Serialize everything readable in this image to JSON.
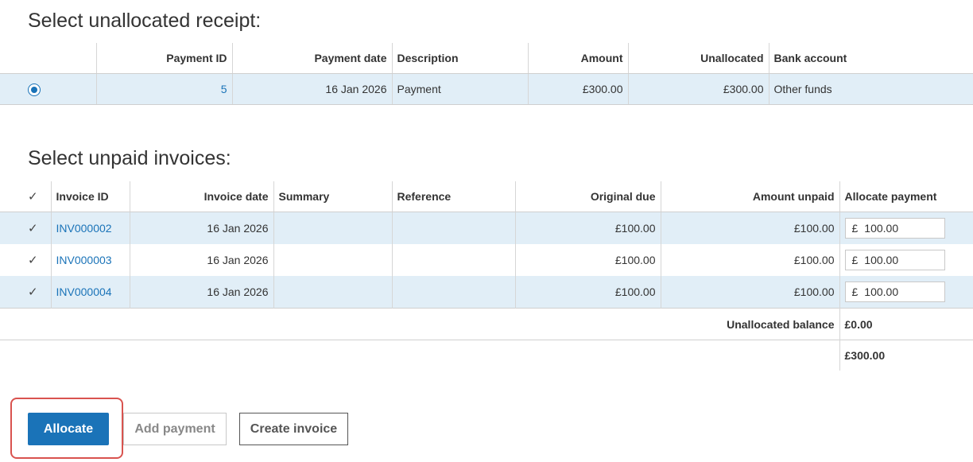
{
  "receipt_section": {
    "title": "Select unallocated receipt:",
    "columns": [
      "Payment ID",
      "Payment date",
      "Description",
      "Amount",
      "Unallocated",
      "Bank account"
    ],
    "row": {
      "selected": true,
      "payment_id": "5",
      "payment_date": "16 Jan 2026",
      "description": "Payment",
      "amount": "£300.00",
      "unallocated": "£300.00",
      "bank_account": "Other funds"
    }
  },
  "invoice_section": {
    "title": "Select unpaid invoices:",
    "select_all_checked": true,
    "columns": [
      "Invoice ID",
      "Invoice date",
      "Summary",
      "Reference",
      "Original due",
      "Amount unpaid",
      "Allocate payment"
    ],
    "rows": [
      {
        "checked": true,
        "invoice_id": "INV000002",
        "invoice_date": "16 Jan 2026",
        "summary": "",
        "reference": "",
        "original_due": "£100.00",
        "amount_unpaid": "£100.00",
        "currency_symbol": "£",
        "allocate_value": "100.00"
      },
      {
        "checked": true,
        "invoice_id": "INV000003",
        "invoice_date": "16 Jan 2026",
        "summary": "",
        "reference": "",
        "original_due": "£100.00",
        "amount_unpaid": "£100.00",
        "currency_symbol": "£",
        "allocate_value": "100.00"
      },
      {
        "checked": true,
        "invoice_id": "INV000004",
        "invoice_date": "16 Jan 2026",
        "summary": "",
        "reference": "",
        "original_due": "£100.00",
        "amount_unpaid": "£100.00",
        "currency_symbol": "£",
        "allocate_value": "100.00"
      }
    ],
    "unallocated_balance_label": "Unallocated balance",
    "unallocated_balance_value": "£0.00",
    "total_value": "£300.00"
  },
  "actions": {
    "allocate_label": "Allocate",
    "add_payment_label": "Add payment",
    "create_invoice_label": "Create invoice"
  },
  "colors": {
    "accent": "#1a73b8",
    "row_highlight": "#e1eef7",
    "annotation_box": "#d9534f"
  },
  "icons": {
    "radio": "radio-selected-icon",
    "check": "checkmark-icon"
  }
}
